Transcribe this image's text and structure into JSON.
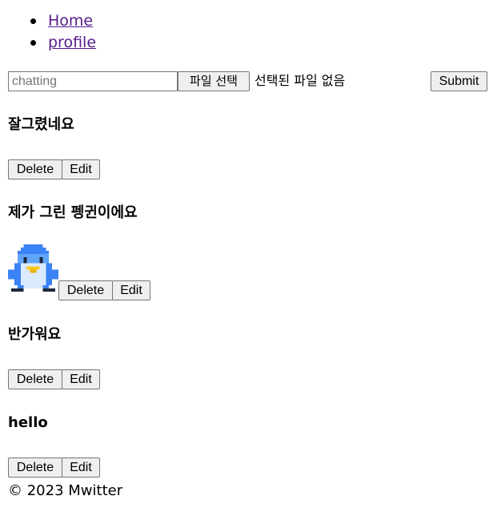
{
  "nav": {
    "items": [
      {
        "label": "Home"
      },
      {
        "label": "profile"
      }
    ]
  },
  "form": {
    "chat_placeholder": "chatting",
    "chat_value": "",
    "file_button_label": "파일 선택",
    "file_status": "선택된 파일 없음",
    "submit_label": "Submit"
  },
  "posts": [
    {
      "text": "잘그렸네요",
      "has_image": false,
      "delete_label": "Delete",
      "edit_label": "Edit"
    },
    {
      "text": "제가 그린 펭귄이에요",
      "has_image": true,
      "image_icon": "penguin-pixel-art",
      "delete_label": "Delete",
      "edit_label": "Edit"
    },
    {
      "text": "반가워요",
      "has_image": false,
      "delete_label": "Delete",
      "edit_label": "Edit"
    },
    {
      "text": "hello",
      "has_image": false,
      "delete_label": "Delete",
      "edit_label": "Edit"
    }
  ],
  "footer": {
    "copyright": "© 2023 Mwitter"
  },
  "colors": {
    "link": "#551a8b",
    "button_bg": "#efefef",
    "border": "#767676",
    "penguin_blue": "#3b82f6",
    "penguin_belly": "#dbeafe",
    "penguin_beak": "#facc15"
  }
}
